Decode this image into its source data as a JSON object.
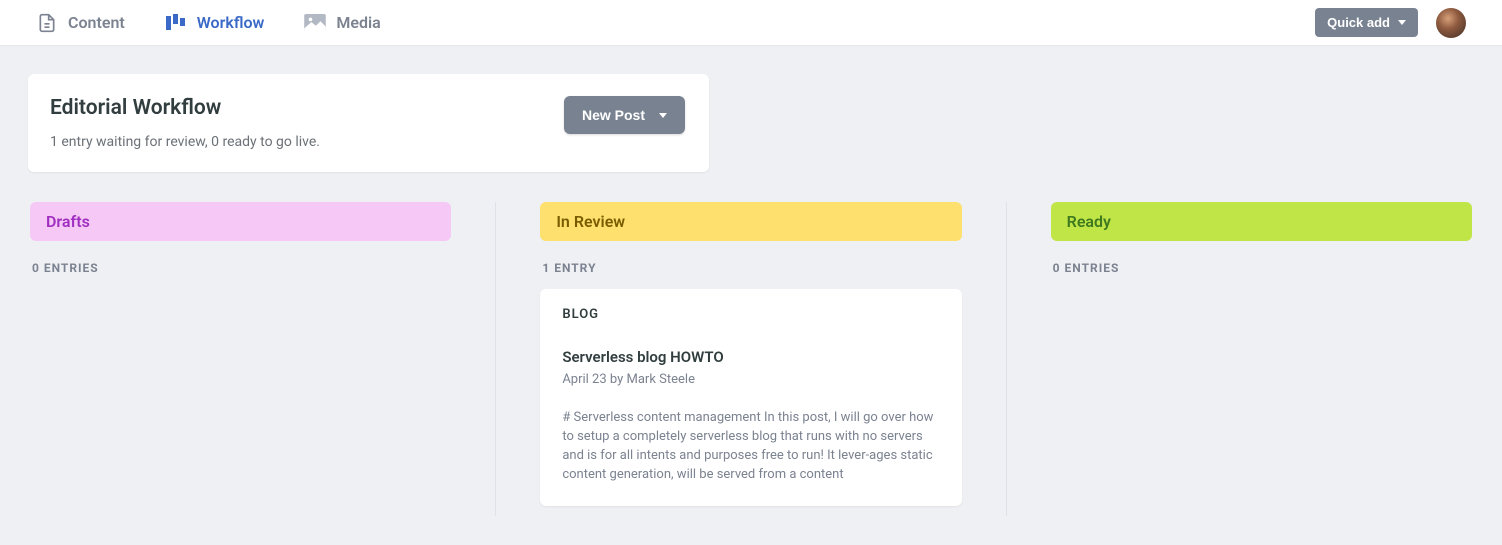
{
  "nav": {
    "content": "Content",
    "workflow": "Workflow",
    "media": "Media"
  },
  "quick_add": "Quick add",
  "header": {
    "title": "Editorial Workflow",
    "subtitle": "1 entry waiting for review, 0 ready to go live.",
    "new_post": "New Post"
  },
  "columns": {
    "drafts": {
      "label": "Drafts",
      "count": "0 ENTRIES"
    },
    "review": {
      "label": "In Review",
      "count": "1 ENTRY"
    },
    "ready": {
      "label": "Ready",
      "count": "0 ENTRIES"
    }
  },
  "card": {
    "collection": "BLOG",
    "title": "Serverless blog HOWTO",
    "meta": "April 23 by Mark Steele",
    "excerpt": "# Serverless content management In this post, I will go over how to setup a completely serverless blog that runs with no servers and is for all intents and purposes free to run! It lever‐ages static content generation, will be served from a content"
  }
}
